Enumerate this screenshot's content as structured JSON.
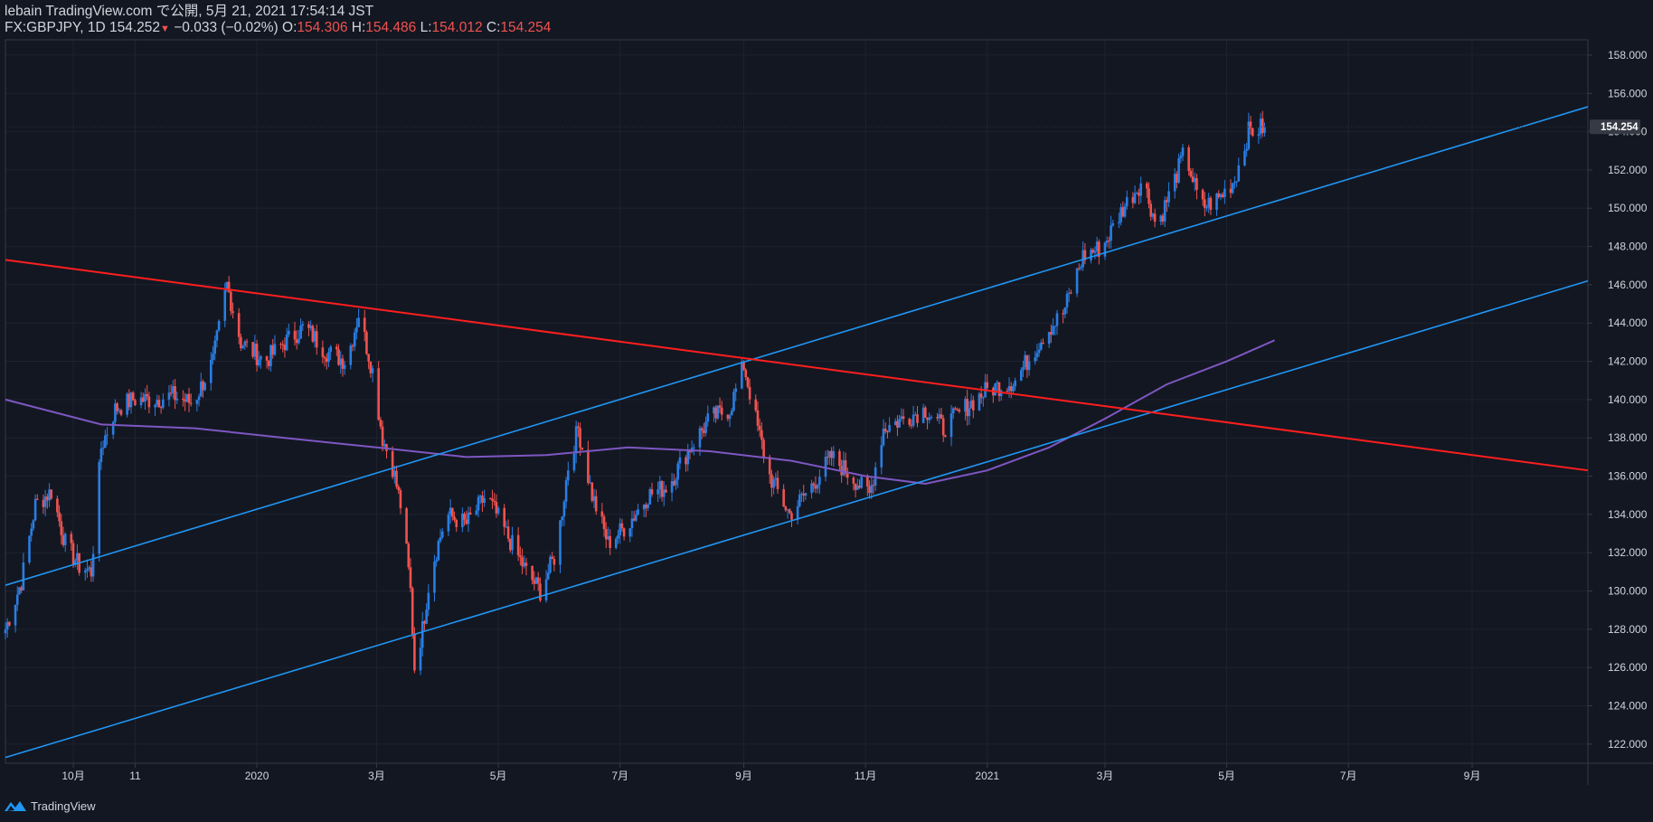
{
  "header": {
    "published": "lebain TradingView.com で公開, 5月 21, 2021 17:54:14 JST",
    "symbol": "FX:GBPJPY, 1D",
    "last": "154.252",
    "down_arrow": "▼",
    "change": "−0.033 (−0.02%)",
    "o_label": "O:",
    "o_value": "154.306",
    "h_label": "H:",
    "h_value": "154.486",
    "l_label": "L:",
    "l_value": "154.012",
    "c_label": "C:",
    "c_value": "154.254"
  },
  "footer": {
    "brand": "TradingView",
    "logo_icon": "tradingview-logo-icon"
  },
  "colors": {
    "background": "#131722",
    "up": "#2962ff",
    "down": "#ef5350",
    "channel": "#2196f3",
    "downtrend": "#ff1e1e",
    "ma": "#7e57c2",
    "grid": "#1e2230",
    "text": "#d1d4dc"
  },
  "chart_data": {
    "type": "candlestick",
    "symbol": "FX:GBPJPY",
    "interval": "1D",
    "ylim": [
      121.0,
      158.8
    ],
    "y_ticks": [
      "158.000",
      "156.000",
      "154.000",
      "152.000",
      "150.000",
      "148.000",
      "146.000",
      "144.000",
      "142.000",
      "140.000",
      "138.000",
      "136.000",
      "134.000",
      "132.000",
      "130.000",
      "128.000",
      "126.000",
      "124.000",
      "122.000"
    ],
    "x_ticks": [
      {
        "label": "10月",
        "date": "2019-10-01"
      },
      {
        "label": "11",
        "date": "2019-11-01"
      },
      {
        "label": "2020",
        "date": "2020-01-01"
      },
      {
        "label": "3月",
        "date": "2020-03-01"
      },
      {
        "label": "5月",
        "date": "2020-05-01"
      },
      {
        "label": "7月",
        "date": "2020-07-01"
      },
      {
        "label": "9月",
        "date": "2020-09-01"
      },
      {
        "label": "11月",
        "date": "2020-11-01"
      },
      {
        "label": "2021",
        "date": "2021-01-01"
      },
      {
        "label": "3月",
        "date": "2021-03-01"
      },
      {
        "label": "5月",
        "date": "2021-05-01"
      },
      {
        "label": "7月",
        "date": "2021-07-01"
      },
      {
        "label": "9月",
        "date": "2021-09-01"
      }
    ],
    "xlim": [
      "2019-08-28",
      "2021-10-29"
    ],
    "last_price": "154.254",
    "series": [
      {
        "date": "2019-08-28",
        "close": 128.0
      },
      {
        "date": "2019-09-05",
        "close": 130.5
      },
      {
        "date": "2019-09-12",
        "close": 134.5
      },
      {
        "date": "2019-09-20",
        "close": 135.2
      },
      {
        "date": "2019-09-27",
        "close": 132.5
      },
      {
        "date": "2019-10-04",
        "close": 131.3
      },
      {
        "date": "2019-10-10",
        "close": 131.0
      },
      {
        "date": "2019-10-15",
        "close": 137.5
      },
      {
        "date": "2019-10-22",
        "close": 139.5
      },
      {
        "date": "2019-10-31",
        "close": 140.0
      },
      {
        "date": "2019-11-10",
        "close": 140.0
      },
      {
        "date": "2019-11-20",
        "close": 140.2
      },
      {
        "date": "2019-11-30",
        "close": 139.8
      },
      {
        "date": "2019-12-10",
        "close": 142.0
      },
      {
        "date": "2019-12-17",
        "close": 146.0
      },
      {
        "date": "2019-12-24",
        "close": 143.0
      },
      {
        "date": "2020-01-05",
        "close": 142.0
      },
      {
        "date": "2020-01-15",
        "close": 143.0
      },
      {
        "date": "2020-01-25",
        "close": 143.8
      },
      {
        "date": "2020-02-05",
        "close": 142.5
      },
      {
        "date": "2020-02-15",
        "close": 142.0
      },
      {
        "date": "2020-02-21",
        "close": 144.5
      },
      {
        "date": "2020-02-28",
        "close": 141.5
      },
      {
        "date": "2020-03-04",
        "close": 138.0
      },
      {
        "date": "2020-03-09",
        "close": 136.5
      },
      {
        "date": "2020-03-14",
        "close": 134.0
      },
      {
        "date": "2020-03-18",
        "close": 130.0
      },
      {
        "date": "2020-03-20",
        "close": 126.0
      },
      {
        "date": "2020-03-24",
        "close": 128.0
      },
      {
        "date": "2020-03-28",
        "close": 131.0
      },
      {
        "date": "2020-04-05",
        "close": 134.0
      },
      {
        "date": "2020-04-15",
        "close": 133.5
      },
      {
        "date": "2020-04-25",
        "close": 135.0
      },
      {
        "date": "2020-05-05",
        "close": 133.0
      },
      {
        "date": "2020-05-15",
        "close": 131.0
      },
      {
        "date": "2020-05-22",
        "close": 130.0
      },
      {
        "date": "2020-05-30",
        "close": 132.0
      },
      {
        "date": "2020-06-05",
        "close": 136.5
      },
      {
        "date": "2020-06-10",
        "close": 138.5
      },
      {
        "date": "2020-06-17",
        "close": 135.0
      },
      {
        "date": "2020-06-25",
        "close": 132.5
      },
      {
        "date": "2020-07-05",
        "close": 133.5
      },
      {
        "date": "2020-07-15",
        "close": 135.0
      },
      {
        "date": "2020-07-25",
        "close": 135.5
      },
      {
        "date": "2020-08-05",
        "close": 137.5
      },
      {
        "date": "2020-08-15",
        "close": 139.0
      },
      {
        "date": "2020-08-25",
        "close": 139.5
      },
      {
        "date": "2020-09-01",
        "close": 141.8
      },
      {
        "date": "2020-09-08",
        "close": 138.5
      },
      {
        "date": "2020-09-14",
        "close": 136.0
      },
      {
        "date": "2020-09-24",
        "close": 134.0
      },
      {
        "date": "2020-10-05",
        "close": 135.5
      },
      {
        "date": "2020-10-15",
        "close": 137.0
      },
      {
        "date": "2020-10-25",
        "close": 136.0
      },
      {
        "date": "2020-11-03",
        "close": 135.0
      },
      {
        "date": "2020-11-10",
        "close": 138.5
      },
      {
        "date": "2020-11-20",
        "close": 139.0
      },
      {
        "date": "2020-12-01",
        "close": 139.5
      },
      {
        "date": "2020-12-10",
        "close": 138.5
      },
      {
        "date": "2020-12-20",
        "close": 139.5
      },
      {
        "date": "2021-01-01",
        "close": 140.5
      },
      {
        "date": "2021-01-15",
        "close": 141.0
      },
      {
        "date": "2021-01-30",
        "close": 143.5
      },
      {
        "date": "2021-02-08",
        "close": 144.5
      },
      {
        "date": "2021-02-18",
        "close": 147.5
      },
      {
        "date": "2021-02-28",
        "close": 148.0
      },
      {
        "date": "2021-03-10",
        "close": 150.0
      },
      {
        "date": "2021-03-20",
        "close": 151.5
      },
      {
        "date": "2021-03-27",
        "close": 149.0
      },
      {
        "date": "2021-04-05",
        "close": 151.5
      },
      {
        "date": "2021-04-10",
        "close": 153.0
      },
      {
        "date": "2021-04-18",
        "close": 150.0
      },
      {
        "date": "2021-04-27",
        "close": 150.5
      },
      {
        "date": "2021-05-05",
        "close": 151.5
      },
      {
        "date": "2021-05-12",
        "close": 154.0
      },
      {
        "date": "2021-05-20",
        "close": 154.25
      }
    ],
    "moving_average": [
      {
        "date": "2019-08-28",
        "value": 140.0
      },
      {
        "date": "2019-10-15",
        "value": 138.7
      },
      {
        "date": "2019-12-01",
        "value": 138.5
      },
      {
        "date": "2020-01-15",
        "value": 138.0
      },
      {
        "date": "2020-03-01",
        "value": 137.5
      },
      {
        "date": "2020-04-15",
        "value": 137.0
      },
      {
        "date": "2020-05-25",
        "value": 137.1
      },
      {
        "date": "2020-07-05",
        "value": 137.5
      },
      {
        "date": "2020-08-15",
        "value": 137.3
      },
      {
        "date": "2020-09-25",
        "value": 136.8
      },
      {
        "date": "2020-11-01",
        "value": 136.0
      },
      {
        "date": "2020-12-01",
        "value": 135.6
      },
      {
        "date": "2021-01-01",
        "value": 136.3
      },
      {
        "date": "2021-02-01",
        "value": 137.5
      },
      {
        "date": "2021-03-01",
        "value": 139.0
      },
      {
        "date": "2021-04-01",
        "value": 140.8
      },
      {
        "date": "2021-05-01",
        "value": 142.0
      },
      {
        "date": "2021-05-25",
        "value": 143.1
      }
    ],
    "trendlines": [
      {
        "name": "upper-channel",
        "color": "#2196f3",
        "p1": {
          "date": "2019-08-28",
          "price": 130.3
        },
        "p2": {
          "date": "2021-10-29",
          "price": 155.3
        }
      },
      {
        "name": "lower-channel",
        "color": "#2196f3",
        "p1": {
          "date": "2019-08-28",
          "price": 121.3
        },
        "p2": {
          "date": "2021-10-29",
          "price": 146.2
        }
      },
      {
        "name": "downtrend",
        "color": "#ff1e1e",
        "p1": {
          "date": "2019-08-28",
          "price": 147.3
        },
        "p2": {
          "date": "2021-10-29",
          "price": 136.3
        }
      }
    ]
  }
}
